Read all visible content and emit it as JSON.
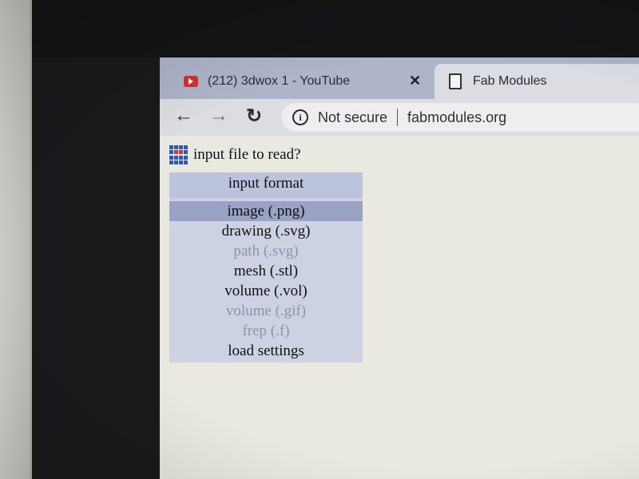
{
  "browser": {
    "tabs": [
      {
        "title": "(212) 3dwox 1 - YouTube",
        "favicon": "youtube-icon",
        "active": false
      },
      {
        "title": "Fab Modules",
        "favicon": "document-icon",
        "active": true
      }
    ],
    "security_label": "Not secure",
    "url": "fabmodules.org"
  },
  "page": {
    "prompt": "input file to read?",
    "menu": {
      "header": "input format",
      "items": [
        {
          "label": "image (.png)",
          "enabled": true,
          "hovered": true
        },
        {
          "label": "drawing (.svg)",
          "enabled": true
        },
        {
          "label": "path (.svg)",
          "enabled": false
        },
        {
          "label": "mesh (.stl)",
          "enabled": true
        },
        {
          "label": "volume (.vol)",
          "enabled": true
        },
        {
          "label": "volume (.gif)",
          "enabled": false
        },
        {
          "label": "frep (.f)",
          "enabled": false
        },
        {
          "label": "load settings",
          "enabled": true
        }
      ]
    }
  },
  "colors": {
    "tab_strip": "#aeb4c9",
    "menu_bg": "#cdd2e3",
    "menu_header": "#bcc3dc",
    "menu_hover": "#9aa3c3",
    "disabled_text": "#8b93ad"
  }
}
